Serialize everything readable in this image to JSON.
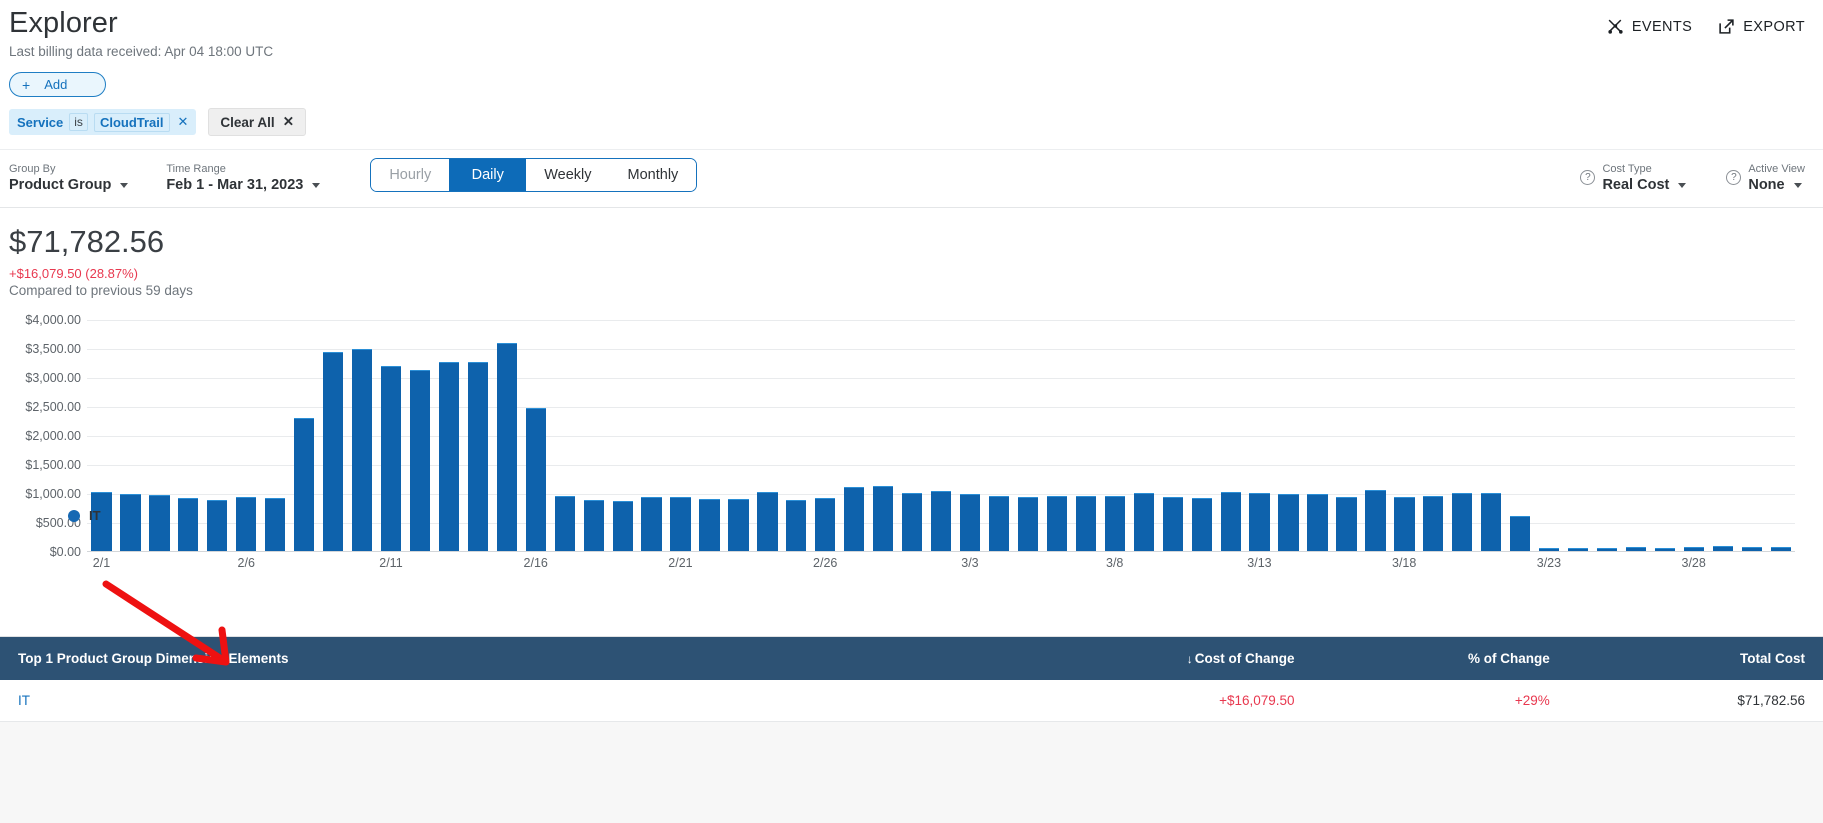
{
  "header": {
    "title": "Explorer",
    "subtitle": "Last billing data received: Apr 04 18:00 UTC",
    "events_label": "EVENTS",
    "export_label": "EXPORT"
  },
  "filters": {
    "add_label": "Add",
    "plus": "+",
    "chip": {
      "key": "Service",
      "operator": "is",
      "value": "CloudTrail",
      "remove": "✕"
    },
    "clear_all_label": "Clear All",
    "clear_all_x": "✕"
  },
  "controls": {
    "group_by": {
      "label": "Group By",
      "value": "Product Group"
    },
    "time_range": {
      "label": "Time Range",
      "value": "Feb 1 - Mar 31, 2023"
    },
    "granularity": {
      "options": [
        "Hourly",
        "Daily",
        "Weekly",
        "Monthly"
      ],
      "selected": "Daily"
    },
    "cost_type": {
      "label": "Cost Type",
      "value": "Real Cost",
      "help": "?"
    },
    "active_view": {
      "label": "Active View",
      "value": "None",
      "help": "?"
    }
  },
  "summary": {
    "total": "$71,782.56",
    "delta": "+$16,079.50 (28.87%)",
    "compare": "Compared to previous 59 days"
  },
  "chart_data": {
    "type": "bar",
    "title": "",
    "xlabel": "",
    "ylabel": "",
    "ylim": [
      0,
      4000
    ],
    "grid": true,
    "legend_position": "bottom-left",
    "series_color": "#0e62ac",
    "ytick_labels": [
      "$4,000.00",
      "$3,500.00",
      "$3,000.00",
      "$2,500.00",
      "$2,000.00",
      "$1,500.00",
      "$1,000.00",
      "$500.00",
      "$0.00"
    ],
    "yticks": [
      4000,
      3500,
      3000,
      2500,
      2000,
      1500,
      1000,
      500,
      0
    ],
    "xtick_labels": [
      "2/1",
      "2/6",
      "2/11",
      "2/16",
      "2/21",
      "2/26",
      "3/3",
      "3/8",
      "3/13",
      "3/18",
      "3/23",
      "3/28"
    ],
    "xtick_indices": [
      0,
      5,
      10,
      15,
      20,
      25,
      30,
      35,
      40,
      45,
      50,
      55
    ],
    "legend": [
      {
        "name": "IT",
        "color": "#1668b3"
      }
    ],
    "categories": [
      "2/1",
      "2/2",
      "2/3",
      "2/4",
      "2/5",
      "2/6",
      "2/7",
      "2/8",
      "2/9",
      "2/10",
      "2/11",
      "2/12",
      "2/13",
      "2/14",
      "2/15",
      "2/16",
      "2/17",
      "2/18",
      "2/19",
      "2/20",
      "2/21",
      "2/22",
      "2/23",
      "2/24",
      "2/25",
      "2/26",
      "2/27",
      "2/28",
      "3/1",
      "3/2",
      "3/3",
      "3/4",
      "3/5",
      "3/6",
      "3/7",
      "3/8",
      "3/9",
      "3/10",
      "3/11",
      "3/12",
      "3/13",
      "3/14",
      "3/15",
      "3/16",
      "3/17",
      "3/18",
      "3/19",
      "3/20",
      "3/21",
      "3/22",
      "3/23",
      "3/24",
      "3/25",
      "3/26",
      "3/27",
      "3/28",
      "3/29",
      "3/30",
      "3/31"
    ],
    "series": [
      {
        "name": "IT",
        "values": [
          1020,
          990,
          970,
          910,
          890,
          930,
          920,
          2300,
          3450,
          3490,
          3200,
          3140,
          3280,
          3270,
          3600,
          2480,
          960,
          890,
          860,
          930,
          930,
          900,
          900,
          1020,
          890,
          920,
          1100,
          1130,
          1010,
          1040,
          990,
          960,
          940,
          960,
          960,
          960,
          1000,
          930,
          910,
          1020,
          1010,
          980,
          990,
          940,
          1060,
          930,
          960,
          1000,
          1000,
          600,
          60,
          55,
          60,
          65,
          60,
          70,
          90,
          65,
          70
        ]
      }
    ],
    "annotation": {
      "type": "arrow",
      "color": "#ee1111",
      "points_to": "2/9"
    }
  },
  "table": {
    "columns": [
      {
        "key": "dimension",
        "label": "Top 1 Product Group Dimension Elements",
        "align": "left",
        "sorted": false
      },
      {
        "key": "cost_of_change",
        "label": "Cost of Change",
        "align": "right",
        "sorted": true,
        "sort_arrow": "↓"
      },
      {
        "key": "pct_of_change",
        "label": "% of Change",
        "align": "right",
        "sorted": false
      },
      {
        "key": "total_cost",
        "label": "Total Cost",
        "align": "right",
        "sorted": false
      }
    ],
    "rows": [
      {
        "dimension": "IT",
        "cost_of_change": "+$16,079.50",
        "pct_of_change": "+29%",
        "total_cost": "$71,782.56"
      }
    ]
  }
}
